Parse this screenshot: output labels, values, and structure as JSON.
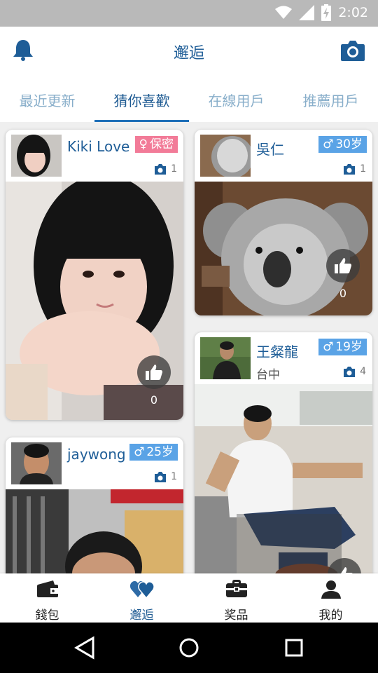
{
  "status_bar": {
    "time": "2:02"
  },
  "app_bar": {
    "title": "邂逅"
  },
  "tabs": [
    {
      "label": "最近更新",
      "active": false
    },
    {
      "label": "猜你喜歡",
      "active": true
    },
    {
      "label": "在線用戶",
      "active": false
    },
    {
      "label": "推薦用戶",
      "active": false
    }
  ],
  "cards": [
    {
      "name": "Kiki Love",
      "gender_symbol": "♀",
      "badge_text": "保密",
      "badge_color": "#f27b98",
      "photo_count": "1",
      "city": "",
      "likes": "0"
    },
    {
      "name": "吳仁",
      "gender_symbol": "♂",
      "badge_text": "30岁",
      "badge_color": "#5aa3e6",
      "photo_count": "1",
      "city": "",
      "likes": "0"
    },
    {
      "name": "王粲龍",
      "gender_symbol": "♂",
      "badge_text": "19岁",
      "badge_color": "#5aa3e6",
      "photo_count": "4",
      "city": "台中",
      "likes": ""
    },
    {
      "name": "jaywong",
      "gender_symbol": "♂",
      "badge_text": "25岁",
      "badge_color": "#5aa3e6",
      "photo_count": "1",
      "city": "",
      "likes": ""
    }
  ],
  "bottom_nav": [
    {
      "label": "錢包",
      "icon": "wallet-icon",
      "active": false
    },
    {
      "label": "邂逅",
      "icon": "hearts-icon",
      "active": true
    },
    {
      "label": "奖品",
      "icon": "prize-icon",
      "active": false
    },
    {
      "label": "我的",
      "icon": "user-icon",
      "active": false
    }
  ],
  "colors": {
    "brand": "#1e5d97",
    "accent": "#1e6fb8",
    "female": "#f27b98",
    "male": "#5aa3e6"
  }
}
